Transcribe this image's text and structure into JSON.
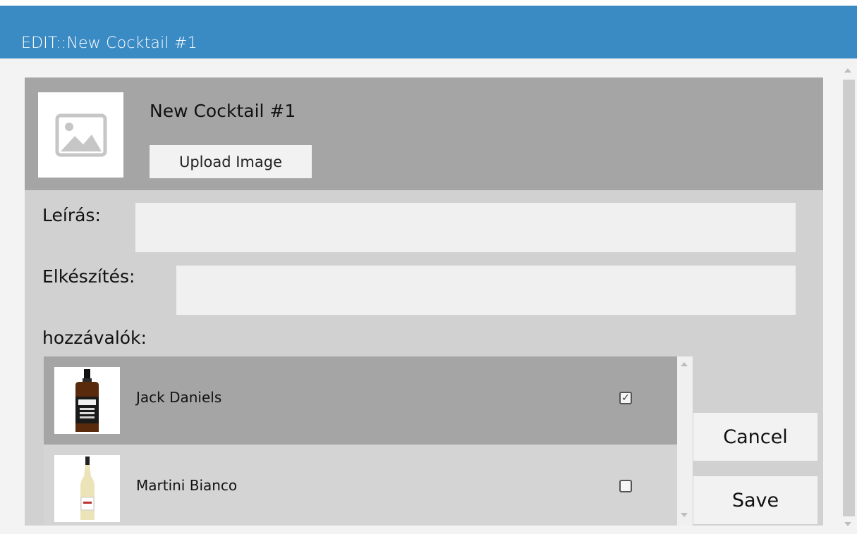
{
  "window": {
    "title": "EDIT::New Cocktail #1",
    "accent_color": "#3a8ac4"
  },
  "cocktail": {
    "name": "New Cocktail #1",
    "image_placeholder_icon": "image-placeholder-icon",
    "upload_label": "Upload Image"
  },
  "form": {
    "description_label": "Leírás:",
    "description_value": "",
    "preparation_label": "Elkészítés:",
    "preparation_value": "",
    "ingredients_label": "hozzávalók:"
  },
  "ingredients": [
    {
      "name": "Jack Daniels",
      "checked": true,
      "selected": true,
      "icon": "whiskey-bottle-image"
    },
    {
      "name": "Martini Bianco",
      "checked": false,
      "selected": false,
      "icon": "martini-bottle-image"
    }
  ],
  "actions": {
    "cancel_label": "Cancel",
    "save_label": "Save"
  }
}
